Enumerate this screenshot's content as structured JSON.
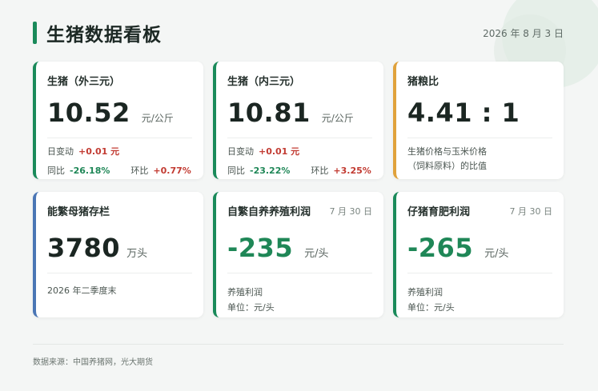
{
  "header": {
    "title": "生猪数据看板",
    "date": "2026 年 8 月 3 日"
  },
  "colors": {
    "accent_green": "#1a8a5a",
    "accent_orange": "#e0a23c",
    "accent_blue": "#4a76b5",
    "up_red": "#c23b32",
    "down_green": "#1f8757"
  },
  "cards": {
    "hog_outer": {
      "title": "生猪（外三元）",
      "value": "10.52",
      "unit": "元/公斤",
      "day_change_label": "日变动",
      "day_change": "+0.01 元",
      "yoy_label": "同比",
      "yoy": "-26.18%",
      "mom_label": "环比",
      "mom": "+0.77%"
    },
    "hog_inner": {
      "title": "生猪（内三元）",
      "value": "10.81",
      "unit": "元/公斤",
      "day_change_label": "日变动",
      "day_change": "+0.01 元",
      "yoy_label": "同比",
      "yoy": "-23.22%",
      "mom_label": "环比",
      "mom": "+3.25%"
    },
    "hog_grain": {
      "title": "猪粮比",
      "value": "4.41 : 1",
      "desc_line1": "生猪价格与玉米价格",
      "desc_line2": "（饲料原料）的比值"
    },
    "sows": {
      "title": "能繁母猪存栏",
      "value": "3780",
      "unit": "万头",
      "desc": "2026 年二季度末"
    },
    "self_breed": {
      "title": "自繁自养养殖利润",
      "date": "7 月 30 日",
      "value": "-235",
      "unit": "元/头",
      "desc_line1": "养殖利润",
      "desc_line2": "单位：元/头"
    },
    "piglet": {
      "title": "仔猪育肥利润",
      "date": "7 月 30 日",
      "value": "-265",
      "unit": "元/头",
      "desc_line1": "养殖利润",
      "desc_line2": "单位：元/头"
    }
  },
  "footer": {
    "source": "数据来源：中国养猪网，光大期货"
  }
}
